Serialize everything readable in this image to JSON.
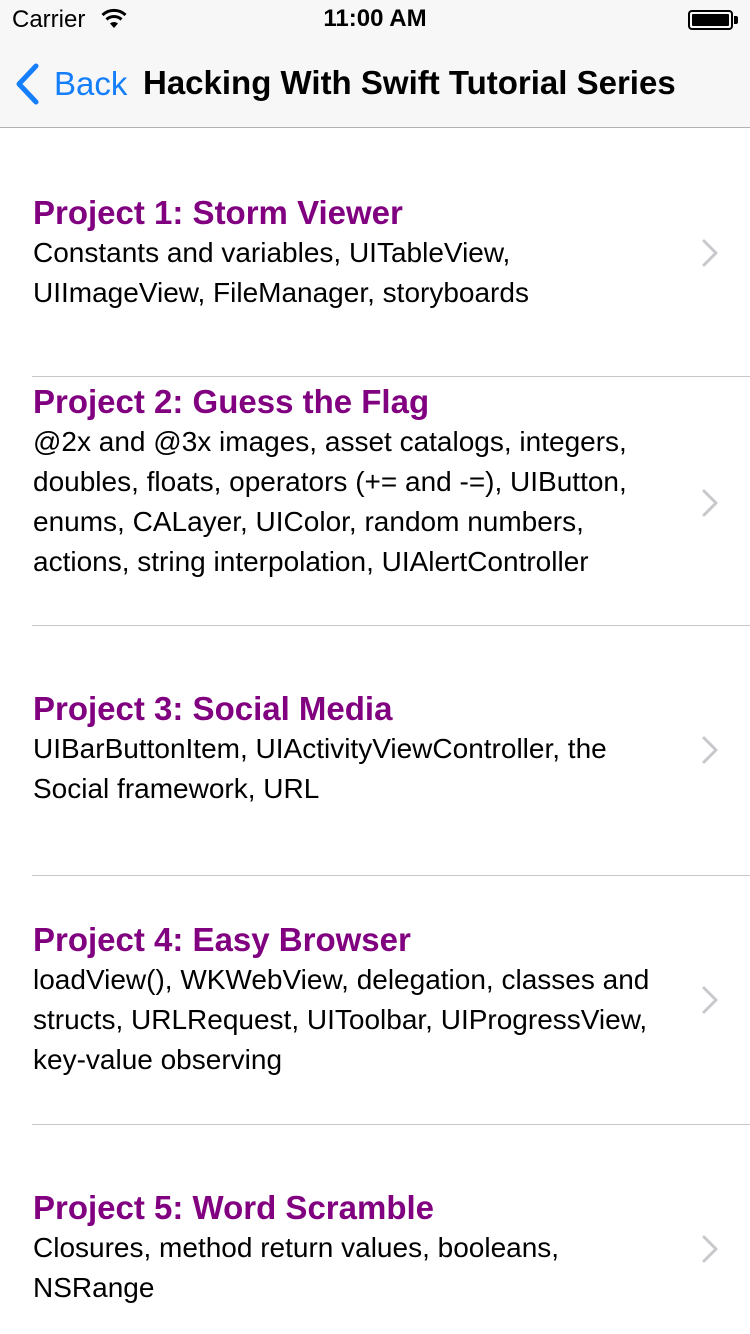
{
  "status_bar": {
    "carrier": "Carrier",
    "time": "11:00 AM"
  },
  "nav_bar": {
    "back_label": "Back",
    "title": "Hacking With Swift Tutorial Series"
  },
  "colors": {
    "accent": "#157efb",
    "title_purple": "#800080"
  },
  "projects": [
    {
      "title": "Project 1: Storm Viewer",
      "subtitle": "Constants and variables, UITableView, UIImageView, FileManager, storyboards"
    },
    {
      "title": "Project 2: Guess the Flag",
      "subtitle": "@2x and @3x images, asset catalogs, integers, doubles, floats, operators (+= and -=), UIButton, enums, CALayer, UIColor, random numbers, actions, string interpolation, UIAlertController"
    },
    {
      "title": "Project 3: Social Media",
      "subtitle": "UIBarButtonItem, UIActivityViewController, the Social framework, URL"
    },
    {
      "title": "Project 4: Easy Browser",
      "subtitle": "loadView(), WKWebView, delegation, classes and structs, URLRequest, UIToolbar, UIProgressView, key-value observing"
    },
    {
      "title": "Project 5: Word Scramble",
      "subtitle": "Closures, method return values, booleans, NSRange"
    }
  ]
}
